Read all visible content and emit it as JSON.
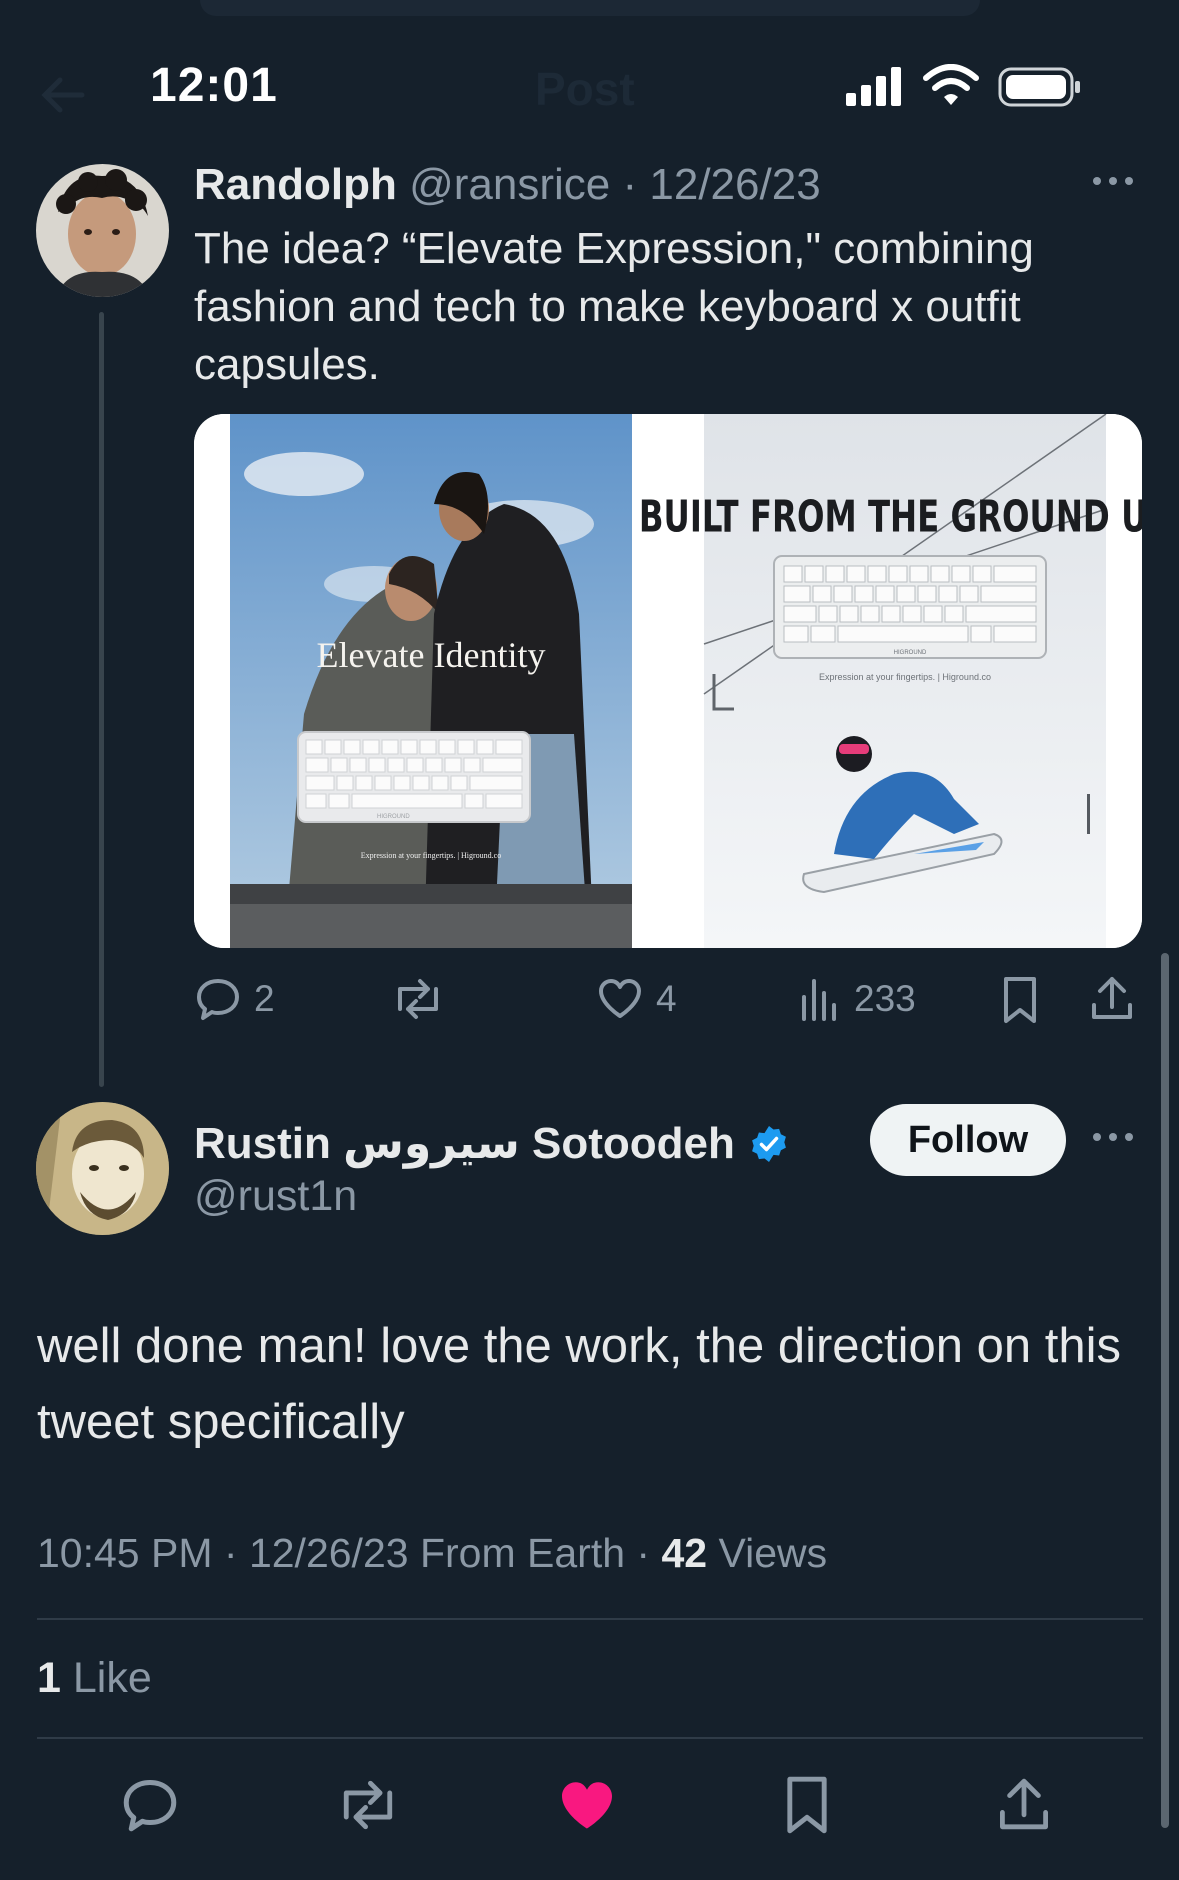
{
  "status_bar": {
    "time": "12:01"
  },
  "header": {
    "title": "Post"
  },
  "parent_tweet": {
    "author_name": "Randolph",
    "author_handle": "@ransrice",
    "separator": "·",
    "date": "12/26/23",
    "text": "The idea? “Elevate Expression,\" combining fashion and tech to make keyboard x outfit capsules.",
    "media": {
      "left_overlay": "Elevate Identity",
      "left_caption": "Expression at your fingertips. | Higround.co",
      "right_headline": "BUILT FROM THE GROUND UP",
      "right_caption": "Expression at your fingertips. | Higround.co",
      "keyboard_brand": "HIGROUND"
    },
    "actions": {
      "replies": "2",
      "likes": "4",
      "views": "233"
    }
  },
  "reply_tweet": {
    "author_name": "Rustin سیروس Sotoodeh",
    "author_handle": "@rust1n",
    "verified": true,
    "follow_label": "Follow",
    "text": "well done man! love the work, the direction on this tweet specifically",
    "time": "10:45 PM",
    "date": "12/26/23",
    "from": "From Earth",
    "views_count": "42",
    "views_label": "Views",
    "likes_count": "1",
    "likes_label": "Like"
  },
  "colors": {
    "background": "#15202b",
    "like_active": "#f91880",
    "verified": "#1d9bf0",
    "muted": "#8b98a5"
  }
}
